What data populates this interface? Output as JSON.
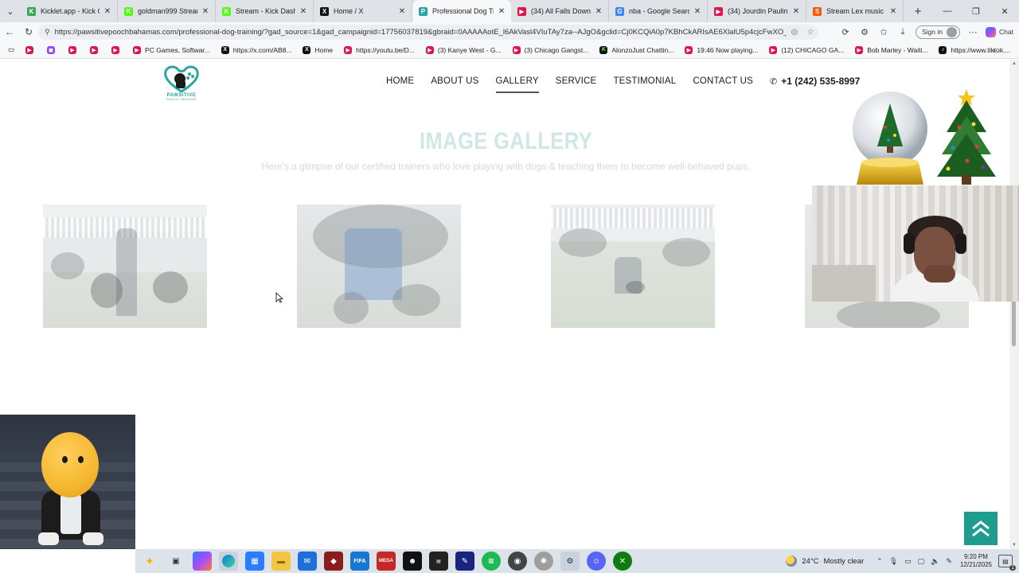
{
  "browser": {
    "tabs": [
      {
        "label": "Kicklet.app - Kick Chatb",
        "color": "#34a853",
        "glyph": "K"
      },
      {
        "label": "goldman999 Stream - W",
        "color": "#53fc18",
        "glyph": "K"
      },
      {
        "label": "Stream - Kick Dashboar",
        "color": "#53fc18",
        "glyph": "K"
      },
      {
        "label": "Home / X",
        "color": "#111111",
        "glyph": "X"
      },
      {
        "label": "Professional Dog Trainin",
        "color": "#2aa6a0",
        "glyph": "P"
      },
      {
        "label": "(34) All Falls Down - You",
        "color": "#e0144c",
        "glyph": "▶"
      },
      {
        "label": "nba - Google Search",
        "color": "#4285f4",
        "glyph": "G"
      },
      {
        "label": "(34) Jourdin Pauline Res",
        "color": "#e0144c",
        "glyph": "▶"
      },
      {
        "label": "Stream Lex music | Liste",
        "color": "#ff5500",
        "glyph": "S"
      }
    ],
    "url": "https://pawsitivepoochbahamas.com/professional-dog-training/?gad_source=1&gad_campaignid=17756037819&gbraid=0AAAAAotE_l6AkVasl4VIuTAy7za--AJgO&gclid=Cj0KCQiA0p7KBhCkARIsAE6XlalU5p4cjcFwXO_bRdtwK...",
    "signin_label": "Sign in",
    "chat_label": "Chat",
    "bookmarks": [
      {
        "label": "",
        "cls": "yt"
      },
      {
        "label": "",
        "cls": "tw"
      },
      {
        "label": "",
        "cls": "yt"
      },
      {
        "label": "",
        "cls": "yt"
      },
      {
        "label": "",
        "cls": "yt"
      },
      {
        "label": "PC Games, Softwar...",
        "cls": "yt"
      },
      {
        "label": "https://x.com/AB8...",
        "cls": "xx"
      },
      {
        "label": "Home",
        "cls": "xx"
      },
      {
        "label": "https://youtu.be/D...",
        "cls": "yt"
      },
      {
        "label": "(3) Kanye West - G...",
        "cls": "yt"
      },
      {
        "label": "(3) Chicago Gangst...",
        "cls": "yt"
      },
      {
        "label": "AlonzoJust Chattin...",
        "cls": "kk"
      },
      {
        "label": "19:46 Now playing...",
        "cls": "yt"
      },
      {
        "label": "(12) CHICAGO GA...",
        "cls": "yt"
      },
      {
        "label": "Bob Marley - Waiti...",
        "cls": "yt"
      },
      {
        "label": "https://www.tiktok....",
        "cls": "tt"
      }
    ]
  },
  "site": {
    "logo_text": "PAWSITIVE",
    "logo_sub": "POOCH TRAINING",
    "menu": [
      "HOME",
      "ABOUT US",
      "GALLERY",
      "SERVICE",
      "TESTIMONIAL",
      "CONTACT US"
    ],
    "active_menu": "GALLERY",
    "phone": "+1 (242) 535-8997",
    "gallery_title": "IMAGE GALLERY",
    "gallery_subtitle": "Here's a glimpse of our certified trainers who love playing with dogs & teaching them to become well-behaved pups.",
    "accent": "#1e9c8e"
  },
  "taskbar": {
    "temperature": "24°C",
    "condition": "Mostly clear",
    "time": "9:20 PM",
    "date": "12/21/2025",
    "notification_count": "1"
  }
}
